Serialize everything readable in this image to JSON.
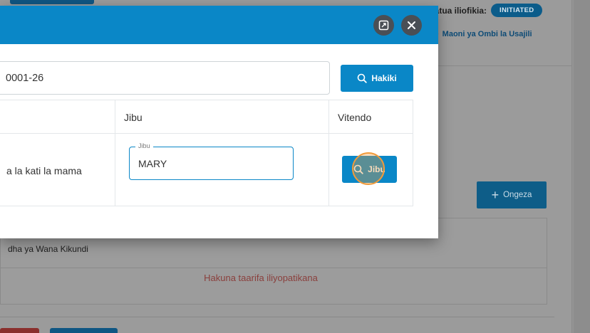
{
  "background": {
    "status_label": "Hatua iliofikia:",
    "status_badge": "INITIATED",
    "breadcrumb_link": "Maoni ya Ombi la Usajili",
    "add_button_label": "Ongeza",
    "members_table_header": "dha ya Wana Kikundi",
    "empty_message": "Hakuna taarifa iliyopatikana"
  },
  "modal": {
    "search_value": "0001-26",
    "verify_button_label": "Hakiki",
    "table": {
      "headers": [
        "Jibu",
        "Vitendo"
      ],
      "rows": [
        {
          "question": "a la kati la mama",
          "answer_label": "Jibu",
          "answer_value": "MARY",
          "action_label": "Jibu"
        }
      ]
    }
  },
  "icons": {
    "fullscreen": "fullscreen-icon",
    "close": "close-icon",
    "search": "search-icon",
    "plus": "plus-icon"
  },
  "colors": {
    "primary": "#0a87c7",
    "badge": "#0b5c8a",
    "empty_text": "#8a3f3c",
    "click_indicator": "#f09a3a"
  }
}
